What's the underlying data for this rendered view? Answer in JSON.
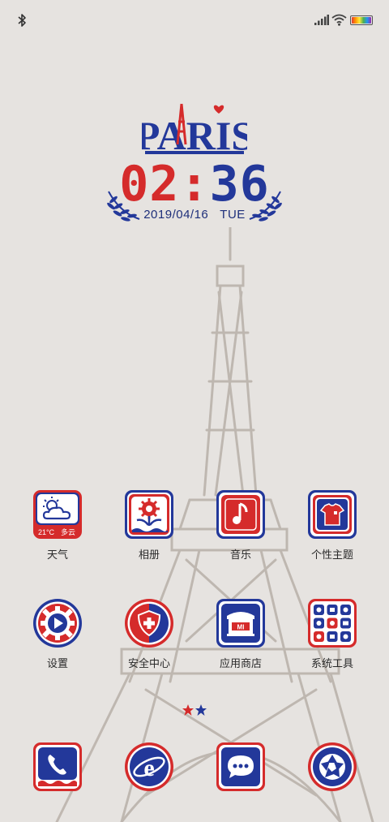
{
  "status_bar": {
    "bluetooth_icon": "bluetooth-icon",
    "signal_icon": "signal-icon",
    "wifi_icon": "wifi-icon",
    "battery_icon": "battery-icon"
  },
  "clock_widget": {
    "logo_text": "PARIS",
    "hours": "02",
    "separator": ":",
    "minutes": "36",
    "date": "2019/04/16",
    "weekday": "TUE",
    "colors": {
      "red": "#d52b2b",
      "blue": "#23389a"
    }
  },
  "apps": [
    {
      "id": "weather",
      "label": "天气",
      "icon": "weather-icon",
      "temp": "21°C",
      "condition": "多云"
    },
    {
      "id": "gallery",
      "label": "相册",
      "icon": "flower-icon"
    },
    {
      "id": "music",
      "label": "音乐",
      "icon": "music-note-icon"
    },
    {
      "id": "themes",
      "label": "个性主题",
      "icon": "tshirt-icon"
    },
    {
      "id": "settings",
      "label": "设置",
      "icon": "gear-icon"
    },
    {
      "id": "security",
      "label": "安全中心",
      "icon": "shield-icon"
    },
    {
      "id": "appstore",
      "label": "应用商店",
      "icon": "store-icon",
      "badge": "MI"
    },
    {
      "id": "tools",
      "label": "系统工具",
      "icon": "folder-grid-icon"
    }
  ],
  "dock": [
    {
      "id": "phone",
      "icon": "phone-icon"
    },
    {
      "id": "browser",
      "icon": "browser-icon"
    },
    {
      "id": "messages",
      "icon": "chat-icon"
    },
    {
      "id": "camera",
      "icon": "camera-aperture-icon"
    }
  ]
}
